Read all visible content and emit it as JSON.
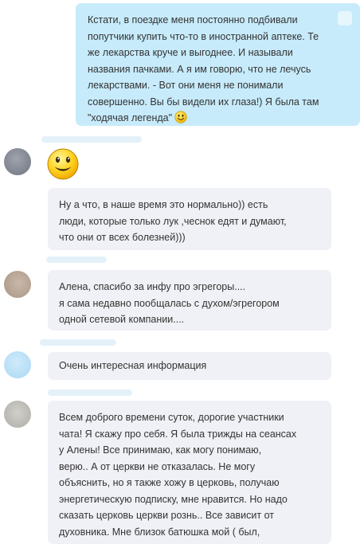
{
  "outgoing": {
    "lines": [
      "Кстати, в поездке меня постоянно подбивали",
      "попутчики купить что-то в иностранной аптеке. Те",
      "же лекарства круче и выгоднее. И называли",
      "названия пачками. А я им говорю, что не лечусь",
      "лекарствами. - Вот они меня не понимали",
      "совершенно. Вы бы видели их глаза!) Я была там",
      "\"ходячая легенда\""
    ],
    "emoji": "smile-emoji"
  },
  "messages": [
    {
      "emoji": "smile-emoji",
      "lines": [
        "Ну а что, в наше время это нормально)) есть",
        "люди, которые только лук ,чеснок едят и думают,",
        "что они от всех болезней)))"
      ]
    },
    {
      "lines": [
        "Алена, спасибо за инфу про эгрегоры....",
        "я сама недавно пообщалась с духом/эгрегором",
        "одной сетевой компании...."
      ]
    },
    {
      "lines": [
        "Очень интересная информация"
      ]
    },
    {
      "lines": [
        "Всем доброго времени суток, дорогие участники",
        "чата! Я скажу про себя. Я была трижды на сеансах",
        "у Алены! Все принимаю, как могу понимаю,",
        "верю.. А от церкви не отказалась. Не могу",
        "объяснить, но я также хожу в церковь, получаю",
        "энергетическую подписку, мне нравится.  Но надо",
        "сказать церковь церкви рознь.. Все зависит от",
        "духовника. Мне близок батюшка мой ( был,"
      ]
    }
  ],
  "colors": {
    "outgoing_bubble": "#c7ebfb",
    "incoming_bubble": "#f0f1f6",
    "emoji_yellow": "#ffd21f"
  }
}
